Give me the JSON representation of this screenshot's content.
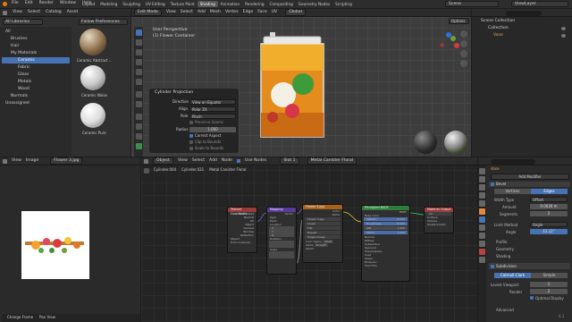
{
  "menus": [
    "File",
    "Edit",
    "Render",
    "Window",
    "Help"
  ],
  "workspaces": [
    "Layout",
    "Modeling",
    "Sculpting",
    "UV Editing",
    "Texture Paint",
    "Shading",
    "Animation",
    "Rendering",
    "Compositing",
    "Geometry Nodes",
    "Scripting"
  ],
  "active_workspace": "Shading",
  "scene": {
    "label": "Scene",
    "view_layer": "ViewLayer"
  },
  "filebrowser": {
    "header": [
      "View",
      "Select",
      "Catalog",
      "Asset"
    ],
    "library": "All Libraries",
    "prefs": "Follow Preferences",
    "tree": [
      "All",
      "Brushes",
      "Hair",
      "My Materials",
      "Ceramic",
      "Fabric",
      "Glass",
      "Metals",
      "Wood",
      "Normals",
      "Unassigned"
    ],
    "selected_tree": "Ceramic",
    "assets": [
      "Ceramic Abstract ...",
      "Ceramic Noise",
      "Ceramic Pure"
    ]
  },
  "viewport": {
    "mode": "Edit Mode",
    "menus": [
      "View",
      "Select",
      "Add",
      "Mesh",
      "Vertex",
      "Edge",
      "Face",
      "UV"
    ],
    "transform": "Global",
    "options": "Options",
    "overlay_title": "User Perspective",
    "overlay_sub": "(1) Flower Container",
    "op_panel": {
      "title": "Cylinder Projection",
      "rows": [
        {
          "label": "Direction",
          "value": "View on Equator"
        },
        {
          "label": "Align",
          "value": "Polar ZX"
        },
        {
          "label": "Pole",
          "value": "Pinch"
        }
      ],
      "check_seams": "Preserve Seams",
      "radius_label": "Radius",
      "radius": "1.000",
      "checks": [
        "Correct Aspect",
        "Clip to Bounds",
        "Scale to Bounds"
      ]
    }
  },
  "outliner": {
    "title": "Scene Collection",
    "items": [
      "Collection",
      "Vase"
    ]
  },
  "image_editor": {
    "menus": [
      "View",
      "Image"
    ],
    "image": "Flower 3.jpg",
    "footer": [
      "Change Frame",
      "Pan View"
    ]
  },
  "node_editor": {
    "menus": [
      "Object",
      "View",
      "Select",
      "Add",
      "Node"
    ],
    "use_nodes": "Use Nodes",
    "slot": "Slot 1",
    "material": "Metal Canister Floral",
    "breadcrumb": [
      "Cylinder.004",
      "Cylinder.021",
      "Metal Canister Floral"
    ],
    "nodes": {
      "coord": {
        "title": "Texture Coordinate",
        "rows": [
          "Generated",
          "Normal",
          "UV",
          "Object",
          "Camera",
          "Window",
          "Reflection",
          "Object",
          "From Instancer"
        ]
      },
      "mapping": {
        "title": "Mapping",
        "rows": [
          "Vector",
          "Type",
          "Point",
          "Location",
          "X",
          "Y",
          "Z",
          "Rotation",
          "Scale"
        ]
      },
      "image": {
        "title": "Flower 3.jpg",
        "rows": [
          "Color",
          "Alpha",
          "Flower 3.jpg",
          "Linear",
          "Flat",
          "Repeat",
          "Single Image",
          "Color Space",
          "sRGB",
          "Alpha",
          "Straight",
          "Vector"
        ]
      },
      "bsdf": {
        "title": "Principled BSDF",
        "rows": [
          "BSDF",
          "Base Color",
          "Metallic",
          "Roughness",
          "IOR",
          "Alpha",
          "Normal",
          "Diffuse",
          "Subsurface",
          "Specular",
          "Transmission",
          "Coat",
          "Sheen",
          "Emission",
          "Thin Film"
        ],
        "values": [
          "0.500",
          "0.500",
          "1.450",
          "1.000"
        ]
      },
      "output": {
        "title": "Material Output",
        "rows": [
          "All",
          "Surface",
          "Volume",
          "Displacement"
        ]
      }
    }
  },
  "properties": {
    "object": "Vase",
    "add_modifier": "Add Modifier",
    "bevel": {
      "name": "Bevel",
      "tabs": [
        "Vertices",
        "Edges"
      ],
      "active_tab": "Edges",
      "rows": [
        {
          "label": "Width Type",
          "value": "Offset"
        },
        {
          "label": "Amount",
          "value": "0.0026 m"
        },
        {
          "label": "Segments",
          "value": "2"
        }
      ],
      "limit_label": "Limit Method",
      "limit_value": "Angle",
      "angle_label": "Angle",
      "angle_value": "43.22°",
      "sections": [
        "Profile",
        "Geometry",
        "Shading"
      ]
    },
    "subsurf": {
      "name": "Subdivision",
      "tabs": [
        "Catmull-Clark",
        "Simple"
      ],
      "active_tab": "Catmull-Clark",
      "levels_label": "Levels Viewport",
      "levels": "1",
      "render_label": "Render",
      "render": "2",
      "optimal": "Optimal Display",
      "advanced": "Advanced"
    }
  },
  "status_version": "4.2"
}
